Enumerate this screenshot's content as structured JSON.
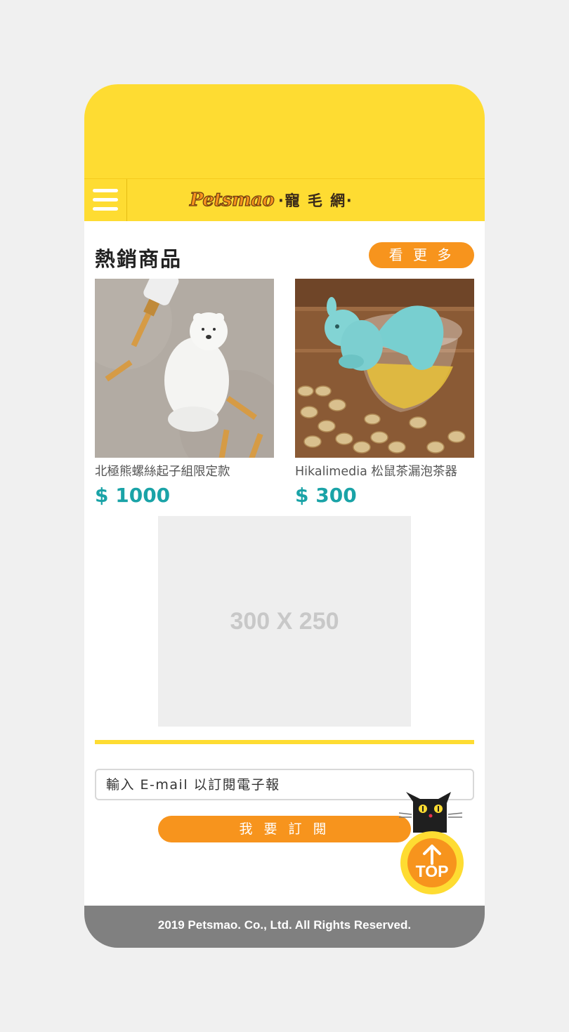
{
  "header": {
    "logo_text": "Petsmao",
    "logo_cn": "‧寵 毛 網‧",
    "menu_icon": "hamburger-icon"
  },
  "hot_products": {
    "title": "熱銷商品",
    "more_label": "看 更 多",
    "items": [
      {
        "name": "北極熊螺絲起子組限定款",
        "price": "$ 1000"
      },
      {
        "name": "Hikalimedia 松鼠茶漏泡茶器",
        "price": "$ 300"
      }
    ]
  },
  "ad": {
    "label": "300 X 250"
  },
  "subscribe": {
    "placeholder": "輸入 E-mail 以訂閱電子報",
    "button_label": "我 要 訂 閱"
  },
  "top_button": {
    "label": "TOP"
  },
  "footer": {
    "copyright": "2019 Petsmao. Co., Ltd. All Rights Reserved."
  },
  "colors": {
    "brand_yellow": "#fedc32",
    "accent_orange": "#f7941d",
    "price_teal": "#1aa3a7",
    "footer_gray": "#808080"
  }
}
